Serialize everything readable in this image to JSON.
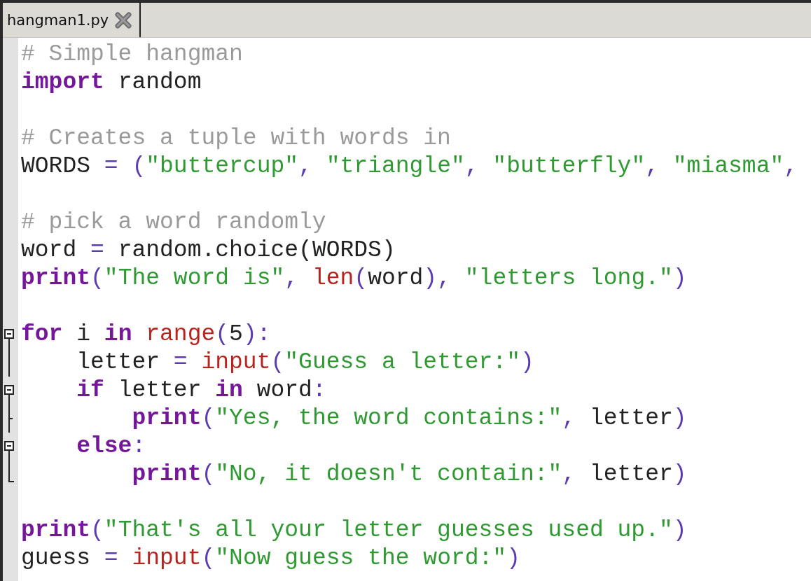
{
  "tabs": [
    {
      "label": "hangman1.py",
      "selected": true
    }
  ],
  "editor": {
    "lines": [
      {
        "kind": "code",
        "tokens": [
          {
            "kind": "comment",
            "text": "# Simple hangman"
          }
        ]
      },
      {
        "kind": "code",
        "tokens": [
          {
            "kind": "keyword",
            "text": "import"
          },
          {
            "kind": "plain",
            "text": " random"
          }
        ]
      },
      {
        "kind": "blank"
      },
      {
        "kind": "code",
        "tokens": [
          {
            "kind": "comment",
            "text": "# Creates a tuple with words in"
          }
        ]
      },
      {
        "kind": "code",
        "tokens": [
          {
            "kind": "plain",
            "text": "WORDS "
          },
          {
            "kind": "operator",
            "text": "= ("
          },
          {
            "kind": "string",
            "text": "\"buttercup\""
          },
          {
            "kind": "operator",
            "text": ", "
          },
          {
            "kind": "string",
            "text": "\"triangle\""
          },
          {
            "kind": "operator",
            "text": ", "
          },
          {
            "kind": "string",
            "text": "\"butterfly\""
          },
          {
            "kind": "operator",
            "text": ", "
          },
          {
            "kind": "string",
            "text": "\"miasma\""
          },
          {
            "kind": "operator",
            "text": ","
          }
        ]
      },
      {
        "kind": "blank"
      },
      {
        "kind": "code",
        "tokens": [
          {
            "kind": "comment",
            "text": "# pick a word randomly"
          }
        ]
      },
      {
        "kind": "code",
        "tokens": [
          {
            "kind": "plain",
            "text": "word "
          },
          {
            "kind": "operator",
            "text": "="
          },
          {
            "kind": "plain",
            "text": " random.choice(WORDS)"
          }
        ]
      },
      {
        "kind": "code",
        "tokens": [
          {
            "kind": "keyword",
            "text": "print"
          },
          {
            "kind": "operator",
            "text": "("
          },
          {
            "kind": "string",
            "text": "\"The word is\""
          },
          {
            "kind": "operator",
            "text": ", "
          },
          {
            "kind": "builtin",
            "text": "len"
          },
          {
            "kind": "operator",
            "text": "("
          },
          {
            "kind": "plain",
            "text": "word"
          },
          {
            "kind": "operator",
            "text": "), "
          },
          {
            "kind": "string",
            "text": "\"letters long.\""
          },
          {
            "kind": "operator",
            "text": ")"
          }
        ]
      },
      {
        "kind": "blank"
      },
      {
        "kind": "foldstart",
        "tokens": [
          {
            "kind": "keyword",
            "text": "for"
          },
          {
            "kind": "plain",
            "text": " i "
          },
          {
            "kind": "keyword",
            "text": "in"
          },
          {
            "kind": "builtin",
            "text": " range"
          },
          {
            "kind": "operator",
            "text": "("
          },
          {
            "kind": "plain",
            "text": "5"
          },
          {
            "kind": "operator",
            "text": "):"
          }
        ]
      },
      {
        "kind": "foldbody",
        "tokens": [
          {
            "kind": "plain",
            "text": "    letter "
          },
          {
            "kind": "operator",
            "text": "="
          },
          {
            "kind": "builtin",
            "text": " input"
          },
          {
            "kind": "operator",
            "text": "("
          },
          {
            "kind": "string",
            "text": "\"Guess a letter:\""
          },
          {
            "kind": "operator",
            "text": ")"
          }
        ]
      },
      {
        "kind": "foldstart",
        "tokens": [
          {
            "kind": "keyword",
            "text": "    if"
          },
          {
            "kind": "plain",
            "text": " letter "
          },
          {
            "kind": "keyword",
            "text": "in"
          },
          {
            "kind": "plain",
            "text": " word"
          },
          {
            "kind": "operator",
            "text": ":"
          }
        ]
      },
      {
        "kind": "foldbranch",
        "tokens": [
          {
            "kind": "keyword",
            "text": "        print"
          },
          {
            "kind": "operator",
            "text": "("
          },
          {
            "kind": "string",
            "text": "\"Yes, the word contains:\""
          },
          {
            "kind": "operator",
            "text": ","
          },
          {
            "kind": "plain",
            "text": " letter"
          },
          {
            "kind": "operator",
            "text": ")"
          }
        ]
      },
      {
        "kind": "foldstart",
        "tokens": [
          {
            "kind": "keyword",
            "text": "    else"
          },
          {
            "kind": "operator",
            "text": ":"
          }
        ]
      },
      {
        "kind": "foldend",
        "tokens": [
          {
            "kind": "keyword",
            "text": "        print"
          },
          {
            "kind": "operator",
            "text": "("
          },
          {
            "kind": "string",
            "text": "\"No, it doesn't contain:\""
          },
          {
            "kind": "operator",
            "text": ","
          },
          {
            "kind": "plain",
            "text": " letter"
          },
          {
            "kind": "operator",
            "text": ")"
          }
        ]
      },
      {
        "kind": "blank"
      },
      {
        "kind": "code",
        "tokens": [
          {
            "kind": "keyword",
            "text": "print"
          },
          {
            "kind": "operator",
            "text": "("
          },
          {
            "kind": "string",
            "text": "\"That's all your letter guesses used up.\""
          },
          {
            "kind": "operator",
            "text": ")"
          }
        ]
      },
      {
        "kind": "code",
        "tokens": [
          {
            "kind": "plain",
            "text": "guess "
          },
          {
            "kind": "operator",
            "text": "="
          },
          {
            "kind": "builtin",
            "text": " input"
          },
          {
            "kind": "operator",
            "text": "("
          },
          {
            "kind": "string",
            "text": "\"Now guess the word:\""
          },
          {
            "kind": "operator",
            "text": ")"
          }
        ]
      }
    ]
  }
}
